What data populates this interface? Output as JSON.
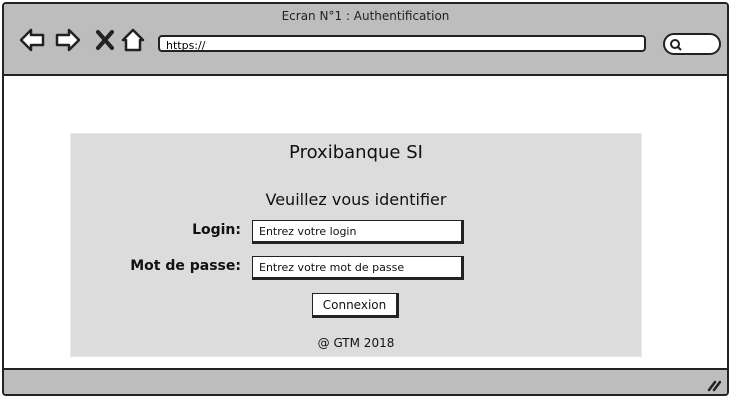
{
  "window": {
    "title": "Ecran N°1 : Authentification"
  },
  "browser": {
    "url": "https://"
  },
  "page": {
    "app_name": "Proxibanque SI",
    "instruction": "Veuillez vous identifier",
    "login_label": "Login:",
    "login_placeholder": "Entrez votre login",
    "password_label": "Mot de passe:",
    "password_placeholder": "Entrez votre mot de passe",
    "submit_label": "Connexion",
    "footer": "@ GTM 2018"
  },
  "colors": {
    "chrome": "#bdbdbd",
    "panel": "#dcdcdc"
  }
}
